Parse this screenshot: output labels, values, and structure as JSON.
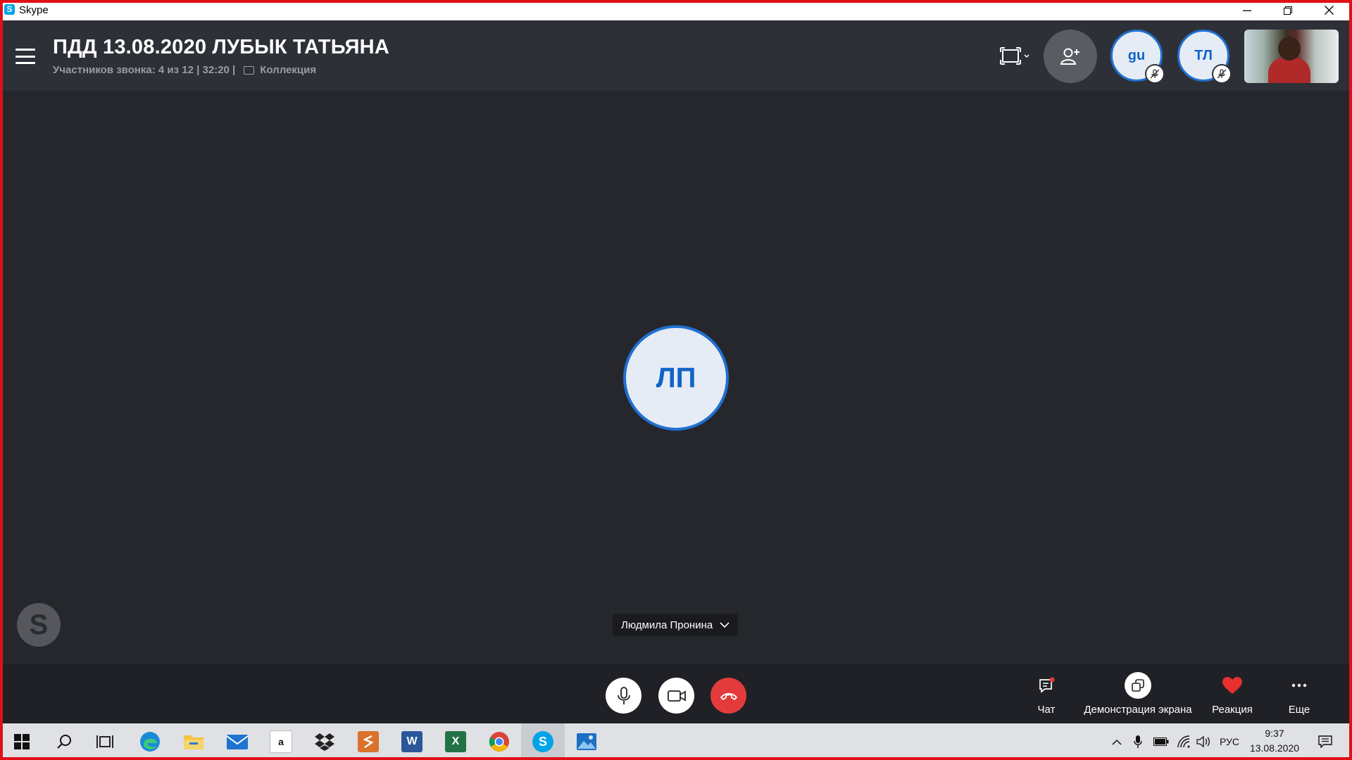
{
  "window": {
    "title": "Skype",
    "app_icon_letter": "S"
  },
  "call": {
    "title": "ПДД 13.08.2020 ЛУБЫК ТАТЬЯНА",
    "participants_text": "Участников звонка: 4 из 12 | 32:20 |",
    "gallery_label": "Коллекция"
  },
  "participants": [
    {
      "initials": "gu",
      "muted": true
    },
    {
      "initials": "ТЛ",
      "muted": true
    }
  ],
  "speaker": {
    "initials": "ЛП",
    "name": "Людмила Пронина"
  },
  "watermark_letter": "S",
  "actions": {
    "chat": "Чат",
    "share": "Демонстрация экрана",
    "reaction": "Реакция",
    "more": "Еще"
  },
  "taskbar": {
    "apps": [
      "windows-start",
      "search",
      "task-view",
      "edge",
      "file-explorer",
      "mail",
      "amazon",
      "dropbox",
      "sublime",
      "word",
      "excel",
      "chrome",
      "skype",
      "photos"
    ],
    "active_app": "skype",
    "amazon_letter": "a",
    "word_letter": "W",
    "excel_letter": "X",
    "skype_letter": "S",
    "language": "РУС",
    "time": "9:37",
    "date": "13.08.2020"
  },
  "colors": {
    "accent": "#1163c8",
    "end_call": "#e33b3b",
    "reaction": "#e8302c",
    "frame": "#e01018"
  }
}
